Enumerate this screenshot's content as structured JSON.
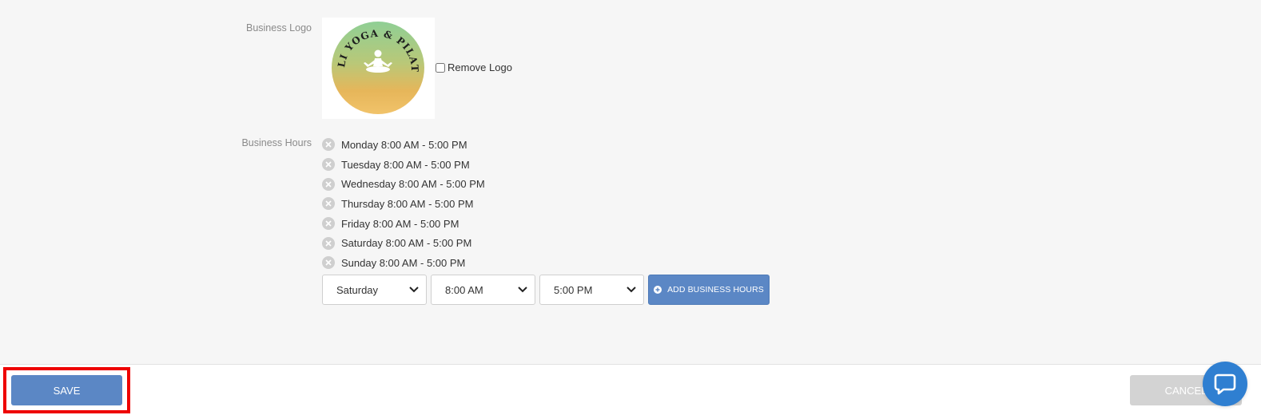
{
  "logo": {
    "label": "Business Logo",
    "logo_text": "FITLI YOGA & PILATES",
    "remove_label": "Remove Logo",
    "remove_checked": false
  },
  "hours": {
    "label": "Business Hours",
    "items": [
      "Monday 8:00 AM - 5:00 PM",
      "Tuesday 8:00 AM - 5:00 PM",
      "Wednesday 8:00 AM - 5:00 PM",
      "Thursday 8:00 AM - 5:00 PM",
      "Friday 8:00 AM - 5:00 PM",
      "Saturday 8:00 AM - 5:00 PM",
      "Sunday 8:00 AM - 5:00 PM"
    ],
    "day_select": "Saturday",
    "start_select": "8:00 AM",
    "end_select": "5:00 PM",
    "add_label": "ADD BUSINESS HOURS"
  },
  "footer": {
    "save_label": "SAVE",
    "cancel_label": "CANCEL"
  },
  "icons": {
    "remove": "x-circle-icon",
    "dropdown": "chevron-down-icon",
    "add": "plus-circle-icon",
    "chat": "chat-bubble-icon"
  },
  "colors": {
    "primary": "#5b87c5",
    "highlight": "#ee0000",
    "disabled": "#d3d3d3",
    "chat": "#2f7fd1"
  }
}
